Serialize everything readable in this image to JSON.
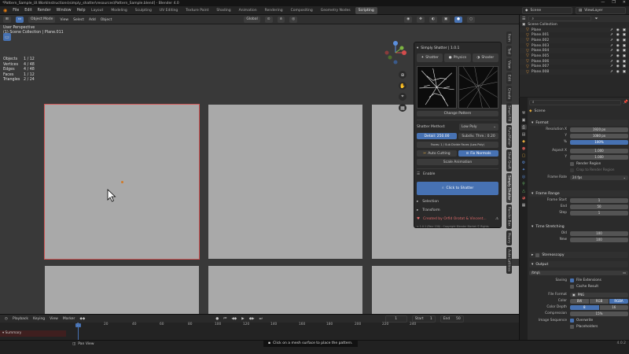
{
  "window": {
    "title": "*Pattern_Sample_UI.WorkInstructions\\simply_shatter\\resources\\Pattern_Sample.blend] - Blender 4.0",
    "controls": [
      "—",
      "❐",
      "✕"
    ]
  },
  "menu": [
    "File",
    "Edit",
    "Render",
    "Window",
    "Help"
  ],
  "workspace_tabs": [
    "Layout",
    "Modeling",
    "Sculpting",
    "UV Editing",
    "Texture Paint",
    "Shading",
    "Animation",
    "Rendering",
    "Compositing",
    "Geometry Nodes",
    "Scripting"
  ],
  "active_tab": "Scripting",
  "scene_field": "Scene",
  "viewlayer_field": "ViewLayer",
  "viewport_header": {
    "mode": "Object Mode",
    "menus": [
      "View",
      "Select",
      "Add",
      "Object"
    ],
    "orientation": "Global",
    "options": "Options"
  },
  "viewport_info": {
    "line1": "User Perspective",
    "line2": "(1) Scene Collection | Plane.011"
  },
  "stats": [
    {
      "label": "Objects",
      "value": "1 / 12"
    },
    {
      "label": "Vertices",
      "value": "4 / 48"
    },
    {
      "label": "Edges",
      "value": "4 / 48"
    },
    {
      "label": "Faces",
      "value": "1 / 12"
    },
    {
      "label": "Triangles",
      "value": "2 / 24"
    }
  ],
  "shatter_panel": {
    "title": "Simply Shatter | 1.0.1",
    "tabs": [
      "Shatter",
      "Physics",
      "Shader"
    ],
    "change_pattern": "Change Pattern",
    "method_label": "Shatter Method:",
    "method_value": "Low Poly",
    "detail_left": "Detail: 250.00",
    "detail_right": "Subdiv. Thre.: 0.20",
    "sides_label": "Faces: 1 / Sub Divide Faces (Low Poly)",
    "auto_cutting": "Auto Cutting",
    "fix_normals": "Fix Normals",
    "scale_animation": "Scale Animation",
    "enable_label": "Enable",
    "click_to_shatter": "Click to Shatter",
    "selection": "Selection",
    "transform": "Transform",
    "credit": "Created by Orfid Orotat & Vincent...",
    "version": "v. 1.0.1 (Rev: 150) - Copyright Blender Market © Rights"
  },
  "vertical_tabs": [
    "Item",
    "Tool",
    "View",
    "Edit",
    "Create",
    "Smart Fill",
    "FuncMaker",
    "Shot Graft",
    "Simply Shatter",
    "Render Box",
    "Heavy",
    "Auto Lattices"
  ],
  "outliner": {
    "root": "Scene Collection",
    "items": [
      "Plane",
      "Plane.001",
      "Plane.002",
      "Plane.003",
      "Plane.004",
      "Plane.005",
      "Plane.006",
      "Plane.007",
      "Plane.008"
    ]
  },
  "properties": {
    "scene_label": "Scene",
    "format": {
      "title": "Format",
      "rows": [
        {
          "label": "Resolution X",
          "value": "1920 px"
        },
        {
          "label": "Y",
          "value": "1080 px"
        },
        {
          "label": "%",
          "value": "100%"
        },
        {
          "label": "Aspect X",
          "value": "1.000"
        },
        {
          "label": "Y",
          "value": "1.000"
        }
      ],
      "render_region": "Render Region",
      "crop": "Crop to Render Region",
      "frame_rate_label": "Frame Rate",
      "frame_rate": "24 fps"
    },
    "frame_range": {
      "title": "Frame Range",
      "rows": [
        {
          "label": "Frame Start",
          "value": "1"
        },
        {
          "label": "End",
          "value": "50"
        },
        {
          "label": "Step",
          "value": "1"
        }
      ]
    },
    "time_stretching": {
      "title": "Time Stretching",
      "rows": [
        {
          "label": "Old",
          "value": "100"
        },
        {
          "label": "New",
          "value": "100"
        }
      ]
    },
    "stereoscopy": "Stereoscopy",
    "output": {
      "title": "Output",
      "path": "/tmp\\",
      "saving_label": "Saving",
      "file_extensions": "File Extensions",
      "cache_result": "Cache Result",
      "file_format_label": "File Format",
      "file_format": "PNG",
      "color_label": "Color",
      "color_options": [
        "BW",
        "RGB",
        "RGBA"
      ],
      "color_depth_label": "Color Depth",
      "color_depth": [
        "8",
        "16"
      ],
      "compression_label": "Compression",
      "compression": "15%",
      "image_sequence_label": "Image Sequence",
      "overwrite": "Overwrite",
      "placeholders": "Placeholders"
    }
  },
  "timeline": {
    "menus": [
      "Playback",
      "Keying",
      "View",
      "Marker"
    ],
    "current_frame": "1",
    "start_label": "Start",
    "start": "1",
    "end_label": "End",
    "end": "50",
    "ticks": [
      "1",
      "20",
      "40",
      "60",
      "80",
      "100",
      "120",
      "140",
      "160",
      "180",
      "200",
      "220",
      "240"
    ],
    "summary": "Summary"
  },
  "status": {
    "left": "Pan View",
    "hint": "Click on a mesh surface to place the pattern.",
    "version": "4.0.2"
  }
}
